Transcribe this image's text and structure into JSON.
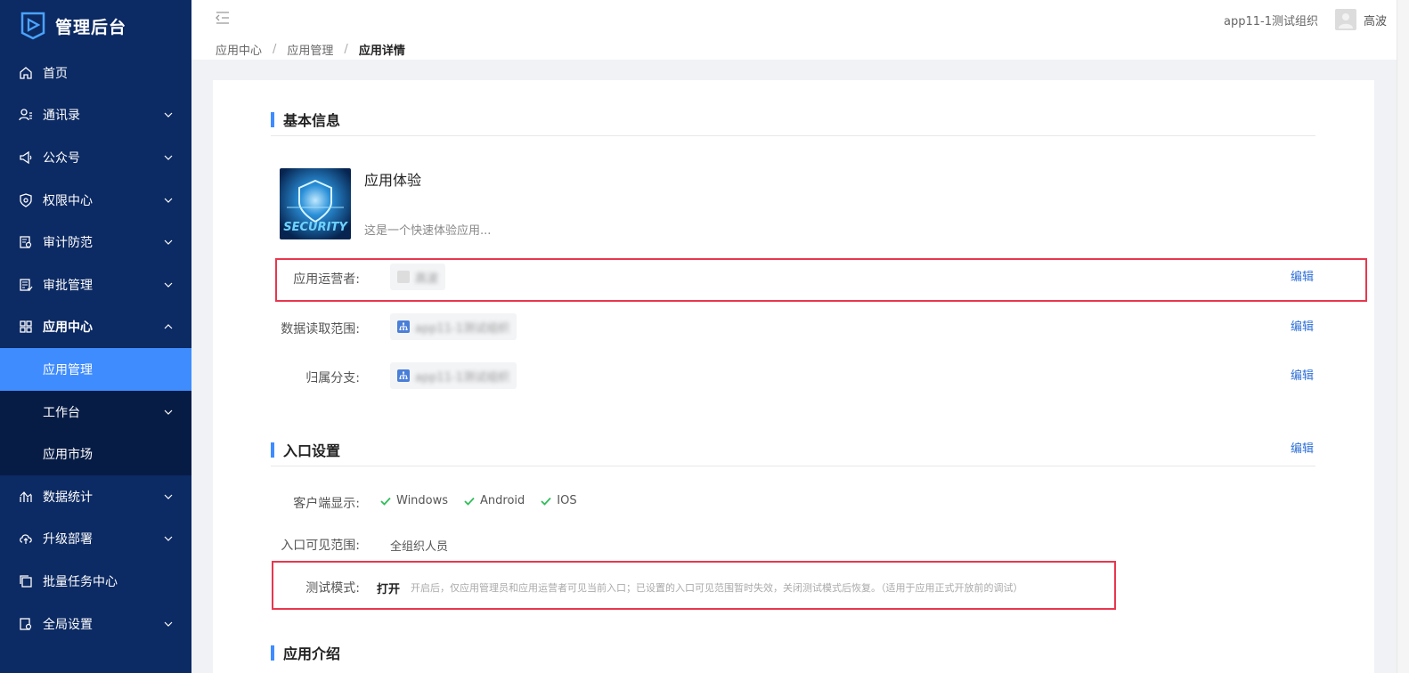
{
  "sidebar": {
    "title": "管理后台",
    "items": [
      {
        "label": "首页",
        "icon": "home-icon",
        "has_chevron": false
      },
      {
        "label": "通讯录",
        "icon": "contacts-icon",
        "has_chevron": true
      },
      {
        "label": "公众号",
        "icon": "megaphone-icon",
        "has_chevron": true
      },
      {
        "label": "权限中心",
        "icon": "shield-icon",
        "has_chevron": true
      },
      {
        "label": "审计防范",
        "icon": "audit-icon",
        "has_chevron": true
      },
      {
        "label": "审批管理",
        "icon": "approval-icon",
        "has_chevron": true
      },
      {
        "label": "应用中心",
        "icon": "grid-icon",
        "has_chevron": true,
        "expanded": true
      }
    ],
    "subitems": [
      {
        "label": "应用管理",
        "active": true,
        "has_chevron": false
      },
      {
        "label": "工作台",
        "active": false,
        "has_chevron": true
      },
      {
        "label": "应用市场",
        "active": false,
        "has_chevron": false
      }
    ],
    "items_after": [
      {
        "label": "数据统计",
        "icon": "chart-icon",
        "has_chevron": true
      },
      {
        "label": "升级部署",
        "icon": "cloud-upload-icon",
        "has_chevron": true
      },
      {
        "label": "批量任务中心",
        "icon": "copy-icon",
        "has_chevron": false
      },
      {
        "label": "全局设置",
        "icon": "settings-icon",
        "has_chevron": true
      }
    ]
  },
  "header": {
    "breadcrumb": [
      "应用中心",
      "应用管理",
      "应用详情"
    ],
    "org": "app11-1测试组织",
    "user": "高波"
  },
  "basic_info": {
    "title": "基本信息",
    "app_name": "应用体验",
    "app_desc": "这是一个快速体验应用...",
    "icon_text": "SECURITY",
    "operator_label": "应用运营者:",
    "operator_value": "高波",
    "data_scope_label": "数据读取范围:",
    "data_scope_value": "app11-1测试组织",
    "branch_label": "归属分支:",
    "branch_value": "app11-1测试组织",
    "edit": "编辑"
  },
  "entry_settings": {
    "title": "入口设置",
    "edit": "编辑",
    "client_label": "客户端显示:",
    "platforms": [
      "Windows",
      "Android",
      "IOS"
    ],
    "visible_label": "入口可见范围:",
    "visible_value": "全组织人员",
    "test_label": "测试模式:",
    "test_value": "打开",
    "test_hint": "开启后，仅应用管理员和应用运营者可见当前入口；已设置的入口可见范围暂时失效，关闭测试模式后恢复。（适用于应用正式开放前的调试）"
  },
  "intro": {
    "title": "应用介绍"
  },
  "colors": {
    "sidebar_bg": "#0c2a63",
    "active_bg": "#3f8cff",
    "accent": "#3f8cff",
    "highlight": "#e8374e",
    "check": "#2ebd59"
  }
}
